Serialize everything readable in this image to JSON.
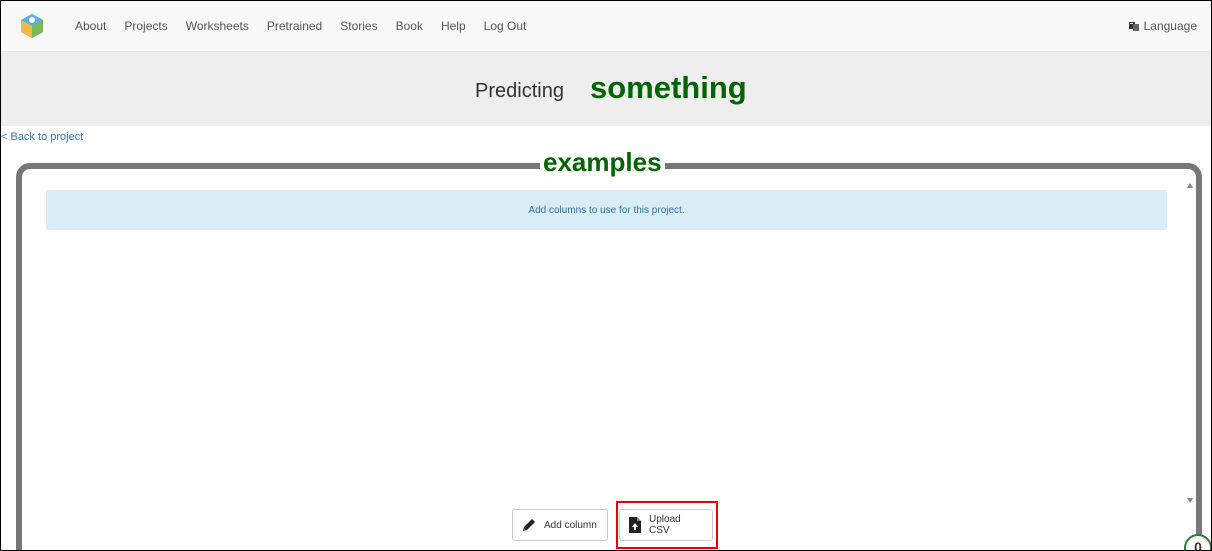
{
  "nav": {
    "items": [
      "About",
      "Projects",
      "Worksheets",
      "Pretrained",
      "Stories",
      "Book",
      "Help",
      "Log Out"
    ],
    "language": "Language"
  },
  "title": {
    "prefix": "Predicting",
    "project": "something"
  },
  "back_link": "< Back to project",
  "section": {
    "title": "examples",
    "info": "Add columns to use for this project."
  },
  "buttons": {
    "add_column": "Add column",
    "upload_csv": "Upload CSV"
  },
  "counter": "0",
  "colors": {
    "accent_green": "#006400",
    "info_bg": "#d9edf7",
    "highlight": "#e00000"
  },
  "icons": {
    "logo": "ml-logo-icon",
    "language": "language-flag-icon",
    "add": "pencil-icon",
    "upload": "upload-file-icon"
  }
}
